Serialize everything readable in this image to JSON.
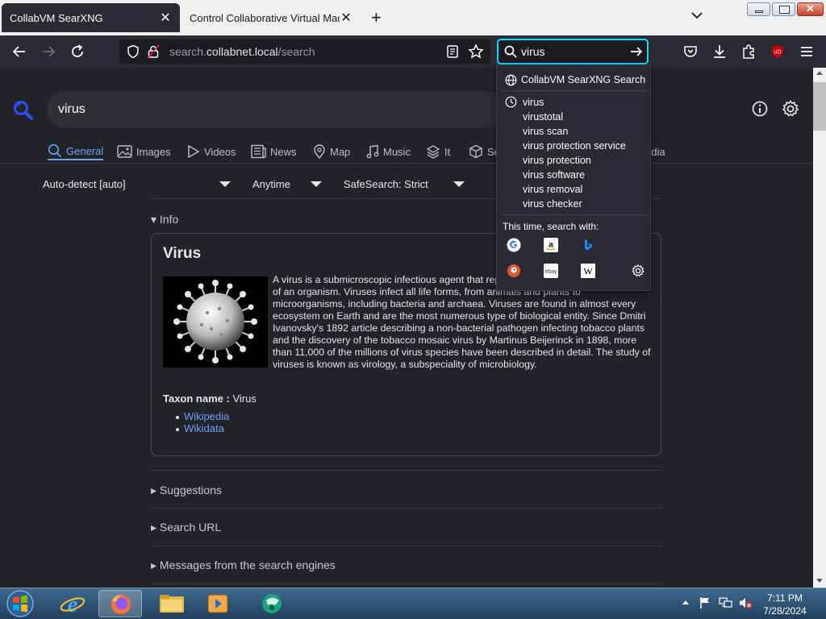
{
  "browser": {
    "tabs": [
      {
        "title": "CollabVM SearXNG",
        "active": true
      },
      {
        "title": "Control Collaborative Virtual Machin",
        "active": false
      }
    ],
    "url_prefix": "search.",
    "url_domain": "collabnet.local",
    "url_path": "/search",
    "search_value": "virus"
  },
  "search": {
    "query": "virus",
    "categories": [
      "General",
      "Images",
      "Videos",
      "News",
      "Map",
      "Music",
      "It",
      "Sci",
      "edia"
    ],
    "active_category": "General",
    "filters": {
      "language": "Auto-detect [auto]",
      "time": "Anytime",
      "safesearch": "SafeSearch: Strict"
    }
  },
  "infobox": {
    "section": "Info",
    "title": "Virus",
    "description": "A virus is a submicroscopic infectious agent that replicates only inside the living cells of an organism. Viruses infect all life forms, from animals and plants to microorganisms, including bacteria and archaea. Viruses are found in almost every ecosystem on Earth and are the most numerous type of biological entity. Since Dmitri Ivanovsky's 1892 article describing a non-bacterial pathogen infecting tobacco plants and the discovery of the tobacco mosaic virus by Martinus Beijerinck in 1898, more than 11,000 of the millions of virus species have been described in detail. The study of viruses is known as virology, a subspeciality of microbiology.",
    "taxon_label": "Taxon name :",
    "taxon_value": "Virus",
    "links": [
      "Wikipedia",
      "Wikidata"
    ]
  },
  "sections": [
    "Suggestions",
    "Search URL",
    "Messages from the search engines"
  ],
  "dropdown": {
    "header": "CollabVM SearXNG Search",
    "suggestions": [
      "virus",
      "virustotal",
      "virus scan",
      "virus protection service",
      "virus protection",
      "virus software",
      "virus removal",
      "virus checker"
    ],
    "engines_label": "This time, search with:",
    "engine_icons": [
      "google-icon",
      "amazon-icon",
      "bing-icon",
      "duckduckgo-icon",
      "ebay-icon",
      "wikipedia-icon",
      "settings-icon"
    ]
  },
  "taskbar": {
    "time": "7:11 PM",
    "date": "7/28/2024"
  }
}
